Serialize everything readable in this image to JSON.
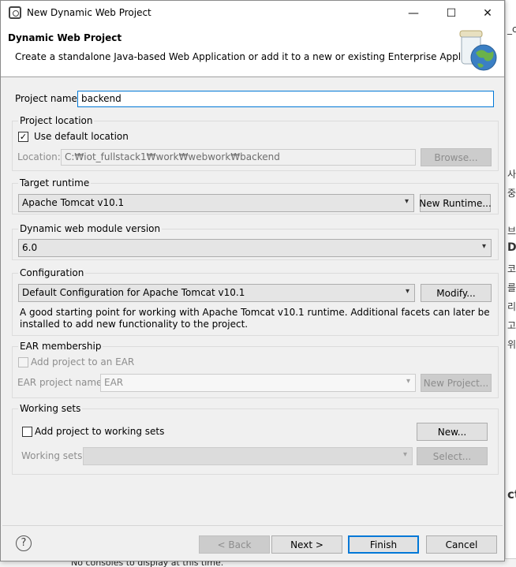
{
  "background": {
    "side_texts": [
      "_cl",
      "사",
      "중",
      "브",
      "D(",
      "코",
      "를",
      "리",
      "고",
      "위",
      "ct"
    ],
    "bottom_text": "No consoles to display at this time."
  },
  "window": {
    "title": "New Dynamic Web Project",
    "minimize": "—",
    "maximize": "☐",
    "close": "✕"
  },
  "header": {
    "title": "Dynamic Web Project",
    "description": "Create a standalone Java-based Web Application or add it to a new or existing Enterprise Application."
  },
  "project_name": {
    "label": "Project name:",
    "value": "backend"
  },
  "project_location": {
    "group_label": "Project location",
    "use_default_label": "Use default location",
    "use_default_checked": "✓",
    "location_label": "Location:",
    "location_value": "C:₩iot_fullstack1₩work₩webwork₩backend",
    "browse_label": "Browse..."
  },
  "target_runtime": {
    "group_label": "Target runtime",
    "selected": "Apache Tomcat v10.1",
    "new_runtime_label": "New Runtime..."
  },
  "module_version": {
    "group_label": "Dynamic web module version",
    "selected": "6.0"
  },
  "configuration": {
    "group_label": "Configuration",
    "selected": "Default Configuration for Apache Tomcat v10.1",
    "modify_label": "Modify...",
    "description": "A good starting point for working with Apache Tomcat v10.1 runtime. Additional facets can later be installed to add new functionality to the project."
  },
  "ear_membership": {
    "group_label": "EAR membership",
    "add_label": "Add project to an EAR",
    "ear_name_label": "EAR project name:",
    "ear_name_value": "EAR",
    "new_project_label": "New Project..."
  },
  "working_sets": {
    "group_label": "Working sets",
    "add_label": "Add project to working sets",
    "new_label": "New...",
    "sets_label": "Working sets:",
    "select_label": "Select..."
  },
  "footer": {
    "help": "?",
    "back": "< Back",
    "next": "Next >",
    "finish": "Finish",
    "cancel": "Cancel"
  },
  "colors": {
    "focus": "#0078d7",
    "dialog_bg": "#f0f0f0"
  },
  "icons": [
    "eclipse-app-icon",
    "minimize-icon",
    "maximize-icon",
    "close-icon",
    "globe-jar-icon",
    "checkmark-icon",
    "chevron-down-icon",
    "help-icon"
  ]
}
